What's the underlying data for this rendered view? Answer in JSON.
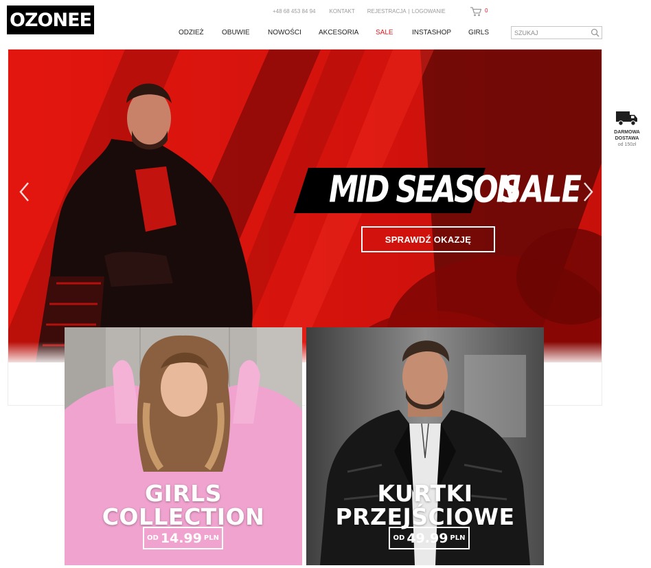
{
  "header": {
    "logo": "OZONEE",
    "phone": "+48 68 453 84 94",
    "contact": "KONTAKT",
    "register": "REJESTRACJA",
    "separator": "|",
    "login": "LOGOWANIE",
    "cart_count": "0",
    "search_placeholder": "SZUKAJ"
  },
  "nav": {
    "items": [
      {
        "label": "ODZIEŻ"
      },
      {
        "label": "OBUWIE"
      },
      {
        "label": "NOWOŚCI"
      },
      {
        "label": "AKCESORIA"
      },
      {
        "label": "SALE"
      },
      {
        "label": "INSTASHOP"
      },
      {
        "label": "GIRLS"
      }
    ]
  },
  "hero": {
    "headline_part1": "MID SEASON",
    "headline_part2": "SALE",
    "cta": "SPRAWDŹ OKAZJĘ"
  },
  "delivery": {
    "line1": "DARMOWA",
    "line2": "DOSTAWA",
    "line3": "od 150zł"
  },
  "promos": [
    {
      "line1": "GIRLS",
      "line2": "COLLECTION",
      "prefix": "OD",
      "price": "14.99",
      "currency": "PLN"
    },
    {
      "line1": "KURTKI",
      "line2": "PRZEJŚCIOWE",
      "prefix": "OD",
      "price": "49.99",
      "currency": "PLN"
    }
  ],
  "colors": {
    "accent_red": "#e31b23",
    "hero_red": "#d3140f",
    "dark": "#000000"
  }
}
